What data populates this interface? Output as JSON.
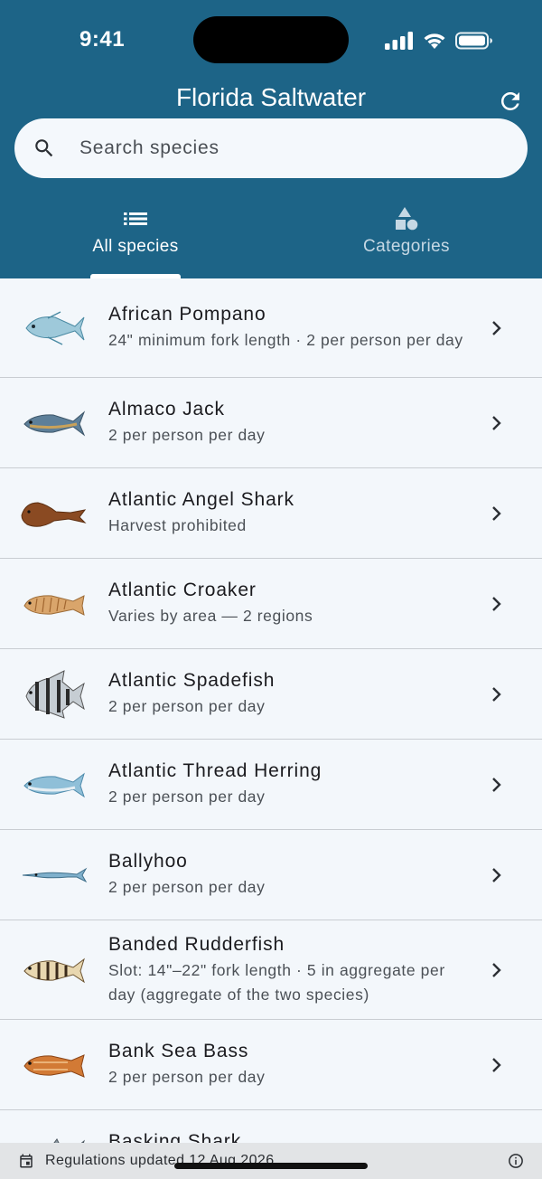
{
  "status_bar": {
    "time": "9:41"
  },
  "header": {
    "title": "Florida Saltwater",
    "search_placeholder": "Search species",
    "tabs": [
      {
        "label": "All species",
        "icon": "list-icon",
        "selected": true
      },
      {
        "label": "Categories",
        "icon": "shapes-icon",
        "selected": false
      }
    ]
  },
  "species": [
    {
      "name": "African Pompano",
      "regulation": "24\" minimum fork length · 2 per person per day",
      "icon": "fish-icon"
    },
    {
      "name": "Almaco Jack",
      "regulation": "2 per person per day",
      "icon": "fish-icon"
    },
    {
      "name": "Atlantic Angel Shark",
      "regulation": "Harvest prohibited",
      "icon": "shark-icon"
    },
    {
      "name": "Atlantic Croaker",
      "regulation": "Varies by area — 2 regions",
      "icon": "fish-icon"
    },
    {
      "name": "Atlantic Spadefish",
      "regulation": "2 per person per day",
      "icon": "fish-icon"
    },
    {
      "name": "Atlantic Thread Herring",
      "regulation": "2 per person per day",
      "icon": "fish-icon"
    },
    {
      "name": "Ballyhoo",
      "regulation": "2 per person per day",
      "icon": "fish-icon"
    },
    {
      "name": "Banded Rudderfish",
      "regulation": "Slot: 14\"–22\" fork length · 5 in aggregate per day (aggregate of the two species)",
      "icon": "fish-icon"
    },
    {
      "name": "Bank Sea Bass",
      "regulation": "2 per person per day",
      "icon": "fish-icon"
    },
    {
      "name": "Basking Shark",
      "regulation": "",
      "icon": "shark-icon"
    }
  ],
  "footer": {
    "text": "Regulations updated 12 Aug 2026"
  },
  "colors": {
    "header": "#1d6487",
    "background": "#f3f7fb",
    "footer": "#e2e4e6"
  }
}
